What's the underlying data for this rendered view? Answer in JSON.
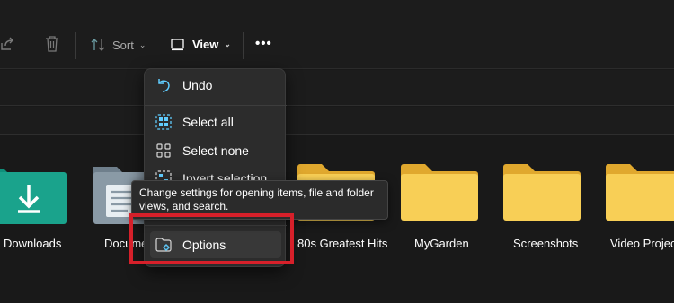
{
  "toolbar": {
    "sort_label": "Sort",
    "view_label": "View",
    "more_label": "•••"
  },
  "menu": {
    "items": [
      {
        "label": "Undo",
        "icon": "undo-icon"
      },
      {
        "label": "Select all",
        "icon": "select-all-icon"
      },
      {
        "label": "Select none",
        "icon": "select-none-icon"
      },
      {
        "label": "Invert selection",
        "icon": "invert-selection-icon"
      },
      {
        "label": "Options",
        "icon": "options-icon"
      }
    ]
  },
  "tooltip": {
    "text": "Change settings for opening items, file and folder views, and search."
  },
  "files": [
    {
      "label": "Downloads",
      "icon": "downloads-folder-icon"
    },
    {
      "label": "Docume",
      "icon": "documents-folder-icon"
    },
    {
      "label": "80s Greatest Hits",
      "icon": "folder-icon"
    },
    {
      "label": "MyGarden",
      "icon": "folder-icon"
    },
    {
      "label": "Screenshots",
      "icon": "folder-icon"
    },
    {
      "label": "Video Project",
      "icon": "folder-icon"
    }
  ],
  "colors": {
    "accent": "#60cdff",
    "folder": "#f5c441",
    "highlight": "#d6202a",
    "downloads_folder": "#1aa38c"
  }
}
